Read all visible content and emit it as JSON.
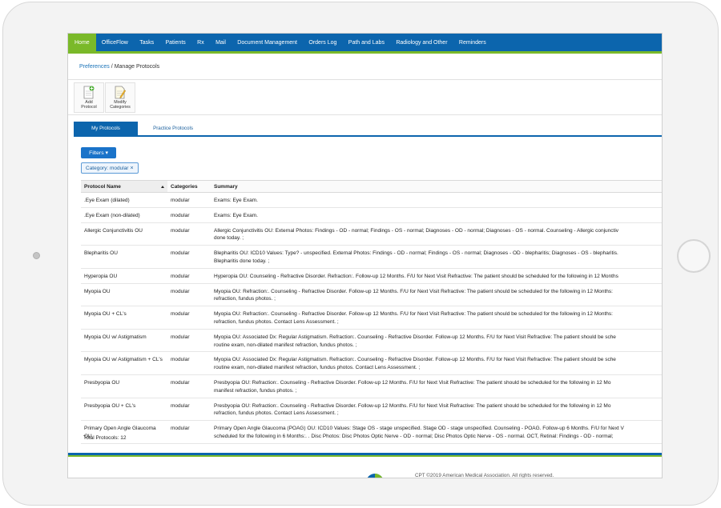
{
  "nav": {
    "items": [
      {
        "label": "Home",
        "active": true
      },
      {
        "label": "OfficeFlow"
      },
      {
        "label": "Tasks"
      },
      {
        "label": "Patients"
      },
      {
        "label": "Rx"
      },
      {
        "label": "Mail"
      },
      {
        "label": "Document Management"
      },
      {
        "label": "Orders Log"
      },
      {
        "label": "Path and Labs"
      },
      {
        "label": "Radiology and Other"
      },
      {
        "label": "Reminders"
      }
    ]
  },
  "breadcrumb": {
    "link": "Preferences",
    "separator": "/",
    "current": "Manage Protocols"
  },
  "toolbar": {
    "add_label_1": "Add",
    "add_label_2": "Protocol",
    "modify_label_1": "Modify",
    "modify_label_2": "Categories"
  },
  "tabs": {
    "my": "My Protocols",
    "practice": "Practice Protocols"
  },
  "filters": {
    "button_label": "Filters ▾",
    "chip_label": "Category: modular",
    "chip_close": "×"
  },
  "table": {
    "headers": {
      "name": "Protocol Name",
      "categories": "Categories",
      "summary": "Summary"
    },
    "rows": [
      {
        "name": ".Eye Exam (dilated)",
        "category": "modular",
        "summary": [
          "Exams: Eye Exam."
        ]
      },
      {
        "name": ".Eye Exam (non-dilated)",
        "category": "modular",
        "summary": [
          "Exams: Eye Exam."
        ]
      },
      {
        "name": "Allergic Conjunctivitis OU",
        "category": "modular",
        "summary": [
          "Allergic Conjunctivitis OU: External Photos: Findings - OD - normal; Findings - OS - normal; Diagnoses - OD - normal; Diagnoses - OS - normal. Counseling - Allergic conjunctiv",
          "done today. ;"
        ]
      },
      {
        "name": "Blepharitis OU",
        "category": "modular",
        "summary": [
          "Blepharitis OU: ICD10 Values: Type? - unspecified. External Photos: Findings - OD - normal; Findings - OS - normal; Diagnoses - OD - blepharitis; Diagnoses - OS - blepharitis.",
          "Blepharitis done today. ;"
        ]
      },
      {
        "name": "Hyperopia OU",
        "category": "modular",
        "summary": [
          "Hyperopia OU: Counseling - Refractive Disorder. Refraction:. Follow-up 12 Months. F/U for Next Visit Refractive: The patient should be scheduled for the following in 12 Months"
        ]
      },
      {
        "name": "Myopia OU",
        "category": "modular",
        "summary": [
          "Myopia OU: Refraction:. Counseling - Refractive Disorder. Follow-up 12 Months. F/U for Next Visit Refractive: The patient should be scheduled for the following in 12 Months:",
          "refraction, fundus photos. ;"
        ]
      },
      {
        "name": "Myopia OU + CL's",
        "category": "modular",
        "summary": [
          "Myopia OU: Refraction:. Counseling - Refractive Disorder. Follow-up 12 Months. F/U for Next Visit Refractive: The patient should be scheduled for the following in 12 Months:",
          "refraction, fundus photos. Contact Lens Assessment. ;"
        ]
      },
      {
        "name": "Myopia OU w/ Astigmatism",
        "category": "modular",
        "summary": [
          "Myopia OU: Associated Dx: Regular Astigmatism. Refraction:. Counseling - Refractive Disorder. Follow-up 12 Months. F/U for Next Visit Refractive: The patient should be sche",
          "routine exam, non-dilated manifest refraction, fundus photos. ;"
        ]
      },
      {
        "name": "Myopia OU w/ Astigmatism + CL's",
        "category": "modular",
        "summary": [
          "Myopia OU: Associated Dx: Regular Astigmatism. Refraction:. Counseling - Refractive Disorder. Follow-up 12 Months. F/U for Next Visit Refractive: The patient should be sche",
          "routine exam, non-dilated manifest refraction, fundus photos. Contact Lens Assessment. ;"
        ]
      },
      {
        "name": "Presbyopia OU",
        "category": "modular",
        "summary": [
          "Presbyopia OU: Refraction:. Counseling - Refractive Disorder. Follow-up 12 Months. F/U for Next Visit Refractive: The patient should be scheduled for the following in 12 Mo",
          "manifest refraction, fundus photos. ;"
        ]
      },
      {
        "name": "Presbyopia OU + CL's",
        "category": "modular",
        "summary": [
          "Presbyopia OU: Refraction:. Counseling - Refractive Disorder. Follow-up 12 Months. F/U for Next Visit Refractive: The patient should be scheduled for the following in 12 Mo",
          "refraction, fundus photos. Contact Lens Assessment. ;"
        ]
      },
      {
        "name": "Primary Open Angle Glaucoma OU",
        "category": "modular",
        "summary": [
          "Primary Open Angle Glaucoma (POAG) OU: ICD10 Values: Stage OS - stage unspecified. Stage OD - stage unspecified. Counseling - POAG. Follow-up 6 Months. F/U for Next V",
          "scheduled for the following in 6 Months:. . Disc Photos: Disc Photos Optic Nerve - OD - normal; Disc Photos Optic Nerve - OS - normal. OCT, Retinal: Findings - OD - normal;"
        ]
      }
    ],
    "total": "Total Protocols: 12"
  },
  "footer": {
    "copyright": "CPT ©2019 American Medical Association. All rights reserved."
  },
  "colors": {
    "nav_blue": "#0c65ad",
    "accent_green": "#7ab929",
    "link_blue": "#1a73b8"
  }
}
